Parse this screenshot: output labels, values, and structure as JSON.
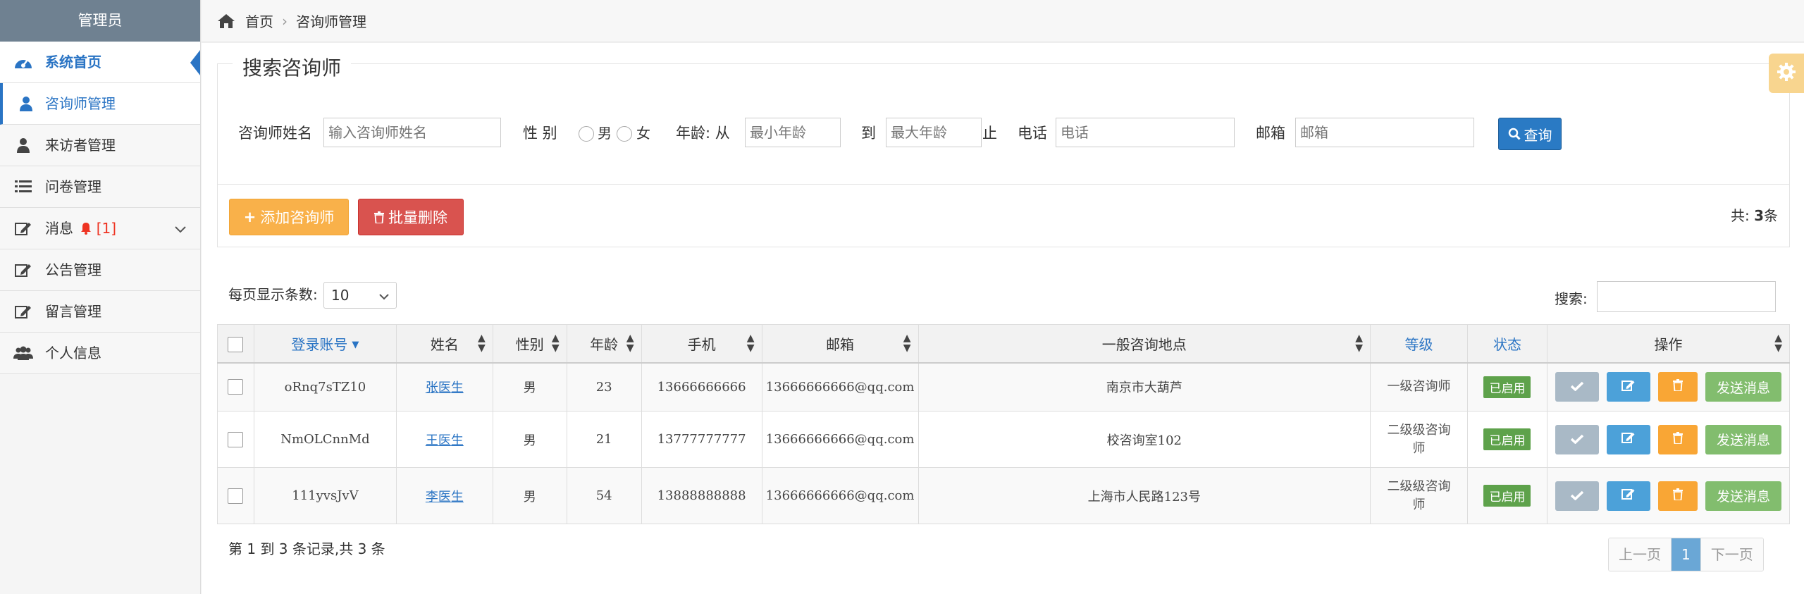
{
  "sidebar": {
    "admin": "管理员",
    "items": [
      {
        "label": "系统首页",
        "icon": "dashboard-icon"
      },
      {
        "label": "咨询师管理",
        "icon": "user-icon"
      },
      {
        "label": "来访者管理",
        "icon": "user-icon"
      },
      {
        "label": "问卷管理",
        "icon": "list-icon"
      },
      {
        "label": "消息",
        "badge": "[1]",
        "icon": "edit-icon"
      },
      {
        "label": "公告管理",
        "icon": "edit-icon"
      },
      {
        "label": "留言管理",
        "icon": "edit-icon"
      },
      {
        "label": "个人信息",
        "icon": "users-icon"
      }
    ]
  },
  "breadcrumb": {
    "home": "首页",
    "current": "咨询师管理"
  },
  "search": {
    "legend": "搜索咨询师",
    "name_label": "咨询师姓名",
    "name_placeholder": "输入咨询师姓名",
    "gender_label": "性 别",
    "male": "男",
    "female": "女",
    "age_label": "年龄: 从",
    "min_age_placeholder": "最小年龄",
    "to": "到",
    "max_age_placeholder": "最大年龄",
    "stop": "止",
    "phone_label": "电话",
    "phone_placeholder": "电话",
    "email_label": "邮箱",
    "email_placeholder": "邮箱",
    "query_button": "查询"
  },
  "actions": {
    "add_button": "添加咨询师",
    "delete_button": "批量删除",
    "total_prefix": "共:",
    "total_count": "3",
    "total_suffix": "条"
  },
  "table_controls": {
    "per_page_label": "每页显示条数:",
    "per_page_value": "10",
    "search_label": "搜索:"
  },
  "table": {
    "columns": [
      "登录账号",
      "姓名",
      "性别",
      "年龄",
      "手机",
      "邮箱",
      "一般咨询地点",
      "等级",
      "状态",
      "操作"
    ],
    "rows": [
      {
        "account": "oRnq7sTZ10",
        "name": "张医生",
        "gender": "男",
        "age": "23",
        "phone": "13666666666",
        "email": "13666666666@qq.com",
        "location": "南京市大葫芦",
        "grade": "一级咨询师",
        "status": "已启用",
        "send": "发送消息"
      },
      {
        "account": "NmOLCnnMd",
        "name": "王医生",
        "gender": "男",
        "age": "21",
        "phone": "13777777777",
        "email": "13666666666@qq.com",
        "location": "校咨询室102",
        "grade": "二级级咨询师",
        "status": "已启用",
        "send": "发送消息"
      },
      {
        "account": "111yvsJvV",
        "name": "李医生",
        "gender": "男",
        "age": "54",
        "phone": "13888888888",
        "email": "13666666666@qq.com",
        "location": "上海市人民路123号",
        "grade": "二级级咨询师",
        "status": "已启用",
        "send": "发送消息"
      }
    ]
  },
  "footer": {
    "records": "第 1 到 3 条记录,共 3 条",
    "prev": "上一页",
    "page": "1",
    "next": "下一页"
  }
}
